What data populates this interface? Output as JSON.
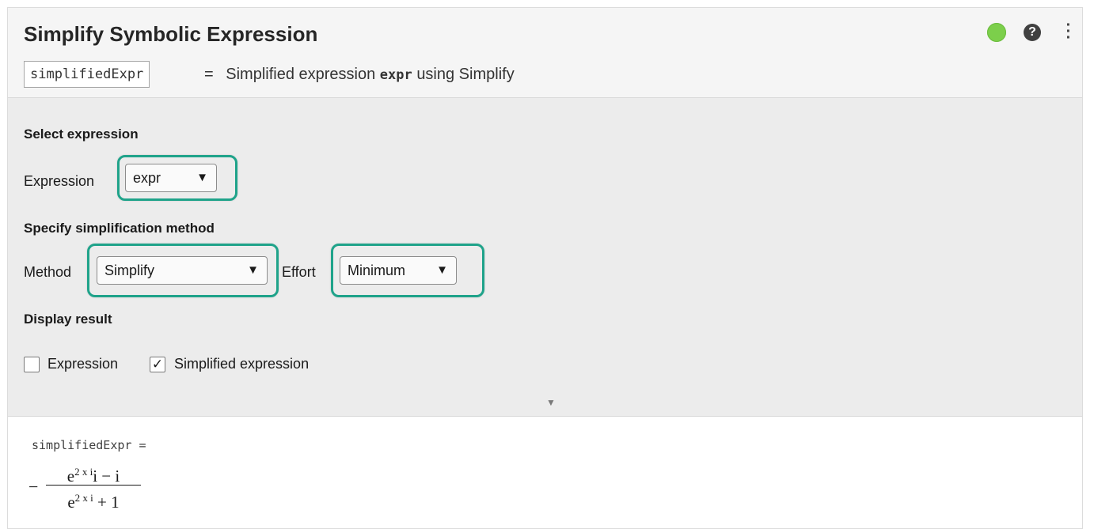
{
  "header": {
    "title": "Simplify Symbolic Expression",
    "output_variable": "simplifiedExpr",
    "summary_eq": "=",
    "summary_prefix": "Simplified expression",
    "summary_code": "expr",
    "summary_suffix": "using Simplify",
    "status_color": "#7ccf4b",
    "help_glyph": "?",
    "menu_glyph": "⋮"
  },
  "controls": {
    "select_expression_heading": "Select expression",
    "expression_label": "Expression",
    "expression_value": "expr",
    "method_heading": "Specify simplification method",
    "method_label": "Method",
    "method_value": "Simplify",
    "effort_label": "Effort",
    "effort_value": "Minimum",
    "display_heading": "Display result",
    "show_expression_label": "Expression",
    "show_expression_checked": false,
    "show_simplified_label": "Simplified expression",
    "show_simplified_checked": true,
    "highlight_color": "#1fa38a",
    "arrow_glyph": "▼"
  },
  "output": {
    "variable_line": "simplifiedExpr =",
    "minus": "−",
    "numerator_base": "e",
    "numerator_exp": "2 x i",
    "numerator_rest": "i − i",
    "denominator_base": "e",
    "denominator_exp": "2 x i",
    "denominator_rest": " + 1"
  }
}
